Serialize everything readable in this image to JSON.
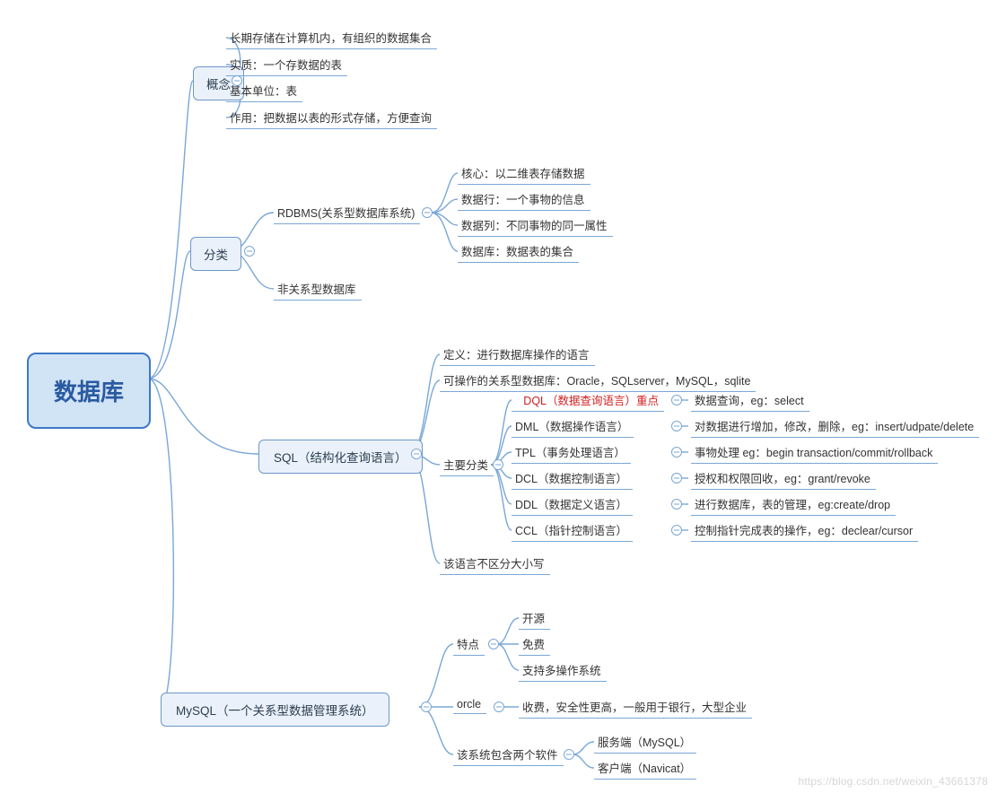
{
  "root": "数据库",
  "watermark": "https://blog.csdn.net/weixin_43661378",
  "branches": {
    "concept": {
      "label": "概念",
      "children": [
        "长期存储在计算机内，有组织的数据集合",
        "实质：一个存数据的表",
        "基本单位：表",
        "作用：把数据以表的形式存储，方便查询"
      ]
    },
    "category": {
      "label": "分类",
      "rdbms": {
        "label": "RDBMS(关系型数据库系统)",
        "children": [
          "核心：以二维表存储数据",
          "数据行：一个事物的信息",
          "数据列：不同事物的同一属性",
          "数据库：数据表的集合"
        ]
      },
      "nonrel": "非关系型数据库"
    },
    "sql": {
      "label": "SQL（结构化查询语言）",
      "def": "定义：进行数据库操作的语言",
      "dbs": "可操作的关系型数据库：Oracle，SQLserver，MySQL，sqlite",
      "mainLabel": "主要分类",
      "main": [
        {
          "name": "DQL（数据查询语言）重点",
          "desc": "数据查询，eg：select",
          "red": true
        },
        {
          "name": "DML（数据操作语言）",
          "desc": "对数据进行增加，修改，删除，eg：insert/udpate/delete"
        },
        {
          "name": "TPL（事务处理语言）",
          "desc": "事物处理 eg：begin transaction/commit/rollback"
        },
        {
          "name": "DCL（数据控制语言）",
          "desc": "授权和权限回收，eg：grant/revoke"
        },
        {
          "name": "DDL（数据定义语言）",
          "desc": "进行数据库，表的管理，eg:create/drop"
        },
        {
          "name": "CCL（指针控制语言）",
          "desc": "控制指针完成表的操作，eg：declear/cursor"
        }
      ],
      "note": "该语言不区分大小写"
    },
    "mysql": {
      "label": "MySQL（一个关系型数据管理系统）",
      "features": {
        "label": "特点",
        "items": [
          "开源",
          "免费",
          "支持多操作系统"
        ]
      },
      "oracle": {
        "label": "orcle",
        "desc": "收费，安全性更高，一般用于银行，大型企业"
      },
      "software": {
        "label": "该系统包含两个软件",
        "items": [
          "服务端（MySQL）",
          "客户端（Navicat）"
        ]
      }
    }
  }
}
